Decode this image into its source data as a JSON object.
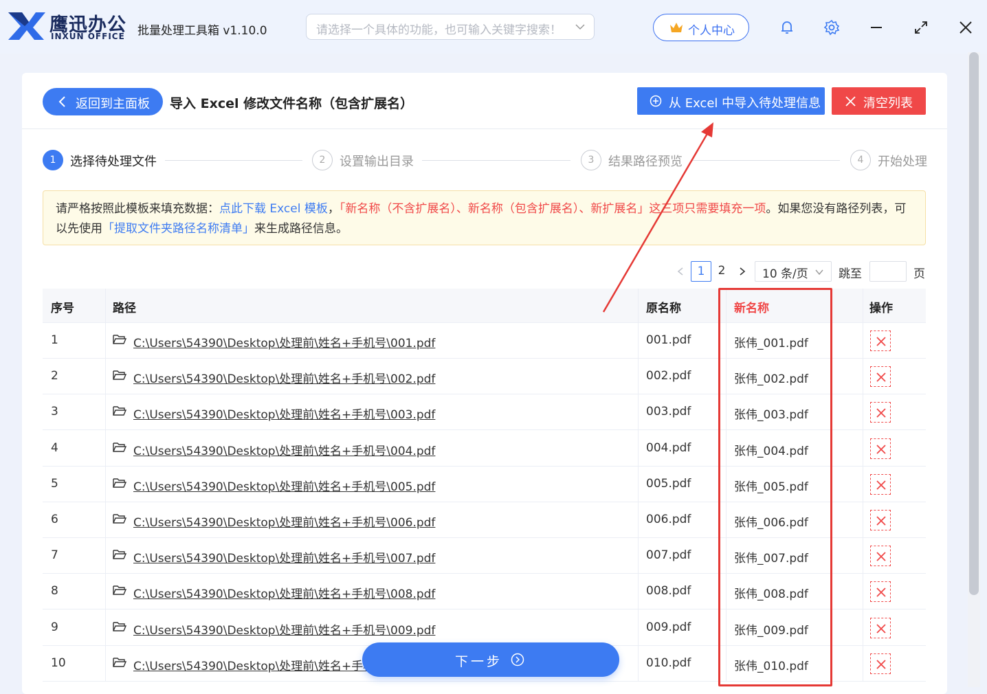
{
  "app": {
    "brand_cn": "鹰迅办公",
    "brand_en": "INXUN OFFICE",
    "title": "批量处理工具箱 v1.10.0",
    "search_placeholder": "请选择一个具体的功能，也可输入关键字搜索！",
    "user_center": "个人中心"
  },
  "header": {
    "back_label": "返回到主面板",
    "page_title": "导入 Excel 修改文件名称（包含扩展名）",
    "import_label": "从 Excel 中导入待处理信息",
    "clear_label": "清空列表"
  },
  "steps": [
    {
      "num": "1",
      "label": "选择待处理文件",
      "active": true
    },
    {
      "num": "2",
      "label": "设置输出目录",
      "active": false
    },
    {
      "num": "3",
      "label": "结果路径预览",
      "active": false
    },
    {
      "num": "4",
      "label": "开始处理",
      "active": false
    }
  ],
  "notice": {
    "part1": "请严格按照此模板来填充数据：",
    "link1": "点此下载 Excel 模板",
    "part2": "，",
    "red": "「新名称（不含扩展名）、新名称（包含扩展名）、新扩展名」这三项只需要填充一项",
    "part3": "。如果您没有路径列表，可以先使用",
    "link2": "「提取文件夹路径名称清单」",
    "part4": "来生成路径信息。"
  },
  "pagination": {
    "pages": [
      "1",
      "2"
    ],
    "current": "1",
    "page_size": "10 条/页",
    "jump_label": "跳至",
    "page_label": "页"
  },
  "table": {
    "headers": {
      "index": "序号",
      "path": "路径",
      "orig": "原名称",
      "new": "新名称",
      "action": "操作"
    },
    "rows": [
      {
        "index": "1",
        "path": "C:\\Users\\54390\\Desktop\\处理前\\姓名+手机号\\001.pdf",
        "orig": "001.pdf",
        "new": "张伟_001.pdf"
      },
      {
        "index": "2",
        "path": "C:\\Users\\54390\\Desktop\\处理前\\姓名+手机号\\002.pdf",
        "orig": "002.pdf",
        "new": "张伟_002.pdf"
      },
      {
        "index": "3",
        "path": "C:\\Users\\54390\\Desktop\\处理前\\姓名+手机号\\003.pdf",
        "orig": "003.pdf",
        "new": "张伟_003.pdf"
      },
      {
        "index": "4",
        "path": "C:\\Users\\54390\\Desktop\\处理前\\姓名+手机号\\004.pdf",
        "orig": "004.pdf",
        "new": "张伟_004.pdf"
      },
      {
        "index": "5",
        "path": "C:\\Users\\54390\\Desktop\\处理前\\姓名+手机号\\005.pdf",
        "orig": "005.pdf",
        "new": "张伟_005.pdf"
      },
      {
        "index": "6",
        "path": "C:\\Users\\54390\\Desktop\\处理前\\姓名+手机号\\006.pdf",
        "orig": "006.pdf",
        "new": "张伟_006.pdf"
      },
      {
        "index": "7",
        "path": "C:\\Users\\54390\\Desktop\\处理前\\姓名+手机号\\007.pdf",
        "orig": "007.pdf",
        "new": "张伟_007.pdf"
      },
      {
        "index": "8",
        "path": "C:\\Users\\54390\\Desktop\\处理前\\姓名+手机号\\008.pdf",
        "orig": "008.pdf",
        "new": "张伟_008.pdf"
      },
      {
        "index": "9",
        "path": "C:\\Users\\54390\\Desktop\\处理前\\姓名+手机号\\009.pdf",
        "orig": "009.pdf",
        "new": "张伟_009.pdf"
      },
      {
        "index": "10",
        "path": "C:\\Users\\54390\\Desktop\\处理前\\姓名+手机号\\010.pdf",
        "orig": "010.pdf",
        "new": "张伟_010.pdf"
      }
    ]
  },
  "footer": {
    "next_label": "下一步"
  },
  "colors": {
    "primary": "#3d7bf2",
    "danger": "#f04848",
    "notice_bg": "#fefbe8"
  }
}
